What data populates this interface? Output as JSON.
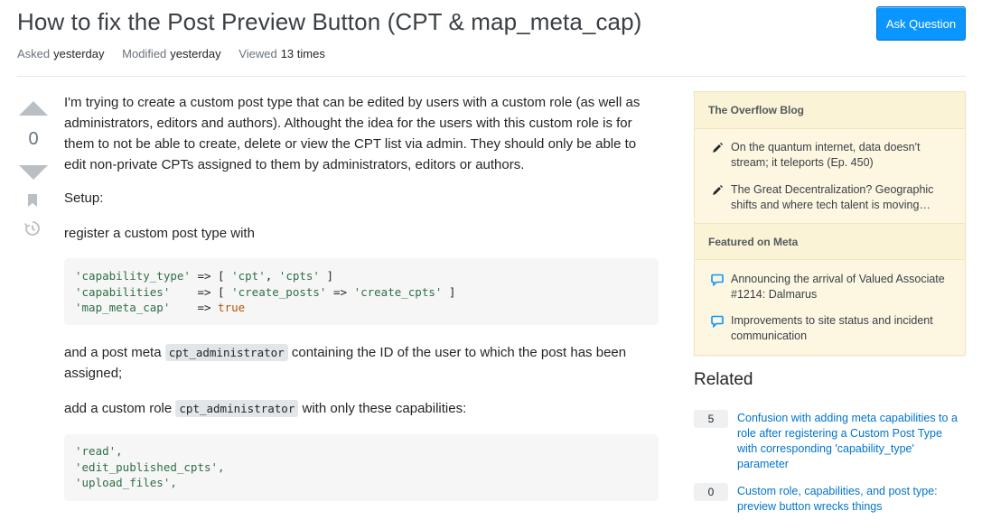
{
  "question": {
    "title": "How to fix the Post Preview Button (CPT & map_meta_cap)",
    "ask_button": "Ask Question",
    "meta": {
      "asked_label": "Asked",
      "asked_value": "yesterday",
      "modified_label": "Modified",
      "modified_value": "yesterday",
      "viewed_label": "Viewed",
      "viewed_value": "13 times"
    },
    "votes": "0"
  },
  "post": {
    "p1": "I'm trying to create a custom post type that can be edited by users with a custom role (as well as administrators, editors and authors). Althought the idea for the users with this custom role is for them to not be able to create, delete or view the CPT list via admin. They should only be able to edit non-private CPTs assigned to them by administrators, editors or authors.",
    "p2": "Setup:",
    "p3": "register a custom post type with",
    "code1": [
      [
        "'capability_type'",
        " => [ ",
        "'cpt'",
        ", ",
        "'cpts'",
        " ]"
      ],
      [
        "'capabilities'",
        "    => [ ",
        "'create_posts'",
        " => ",
        "'create_cpts'",
        " ]"
      ],
      [
        "'map_meta_cap'",
        "    => ",
        "true"
      ]
    ],
    "p4_before": "and a post meta ",
    "p4_code": "cpt_administrator",
    "p4_after": " containing the ID of the user to which the post has been assigned;",
    "p5_before": "add a custom role ",
    "p5_code": "cpt_administrator",
    "p5_after": " with only these capabilities:",
    "code2": [
      "'read',",
      "'edit_published_cpts',",
      "'upload_files',"
    ]
  },
  "sidebar": {
    "blog_header": "The Overflow Blog",
    "blog_items": [
      {
        "icon": "pencil-icon",
        "text": "On the quantum internet, data doesn't stream; it teleports (Ep. 450)"
      },
      {
        "icon": "pencil-icon",
        "text": "The Great Decentralization? Geographic shifts and where tech talent is moving…"
      }
    ],
    "meta_header": "Featured on Meta",
    "meta_items": [
      {
        "icon": "chat-bubble-icon",
        "text": "Announcing the arrival of Valued Associate #1214: Dalmarus"
      },
      {
        "icon": "chat-bubble-icon",
        "text": "Improvements to site status and incident communication"
      }
    ]
  },
  "related": {
    "title": "Related",
    "items": [
      {
        "score": "5",
        "text": "Confusion with adding meta capabilities to a role after registering a Custom Post Type with corresponding 'capability_type' parameter"
      },
      {
        "score": "0",
        "text": "Custom role, capabilities, and post type: preview button wrecks things"
      }
    ]
  },
  "colors": {
    "accent": "#0a95ff",
    "link": "#0074cc",
    "string": "#2f6f44",
    "keyword": "#b75301",
    "sidebar_bg": "#fdf7e2"
  }
}
